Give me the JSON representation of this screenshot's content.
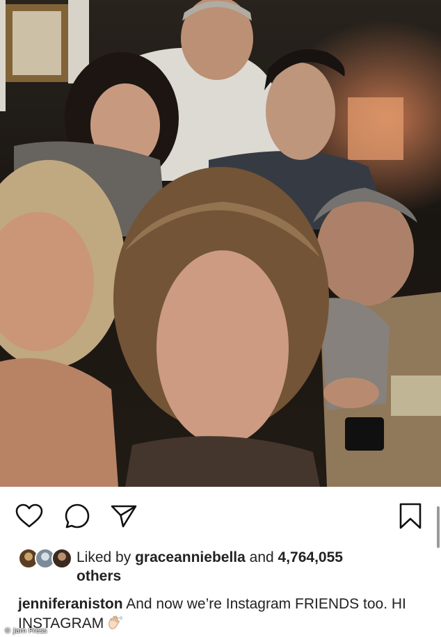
{
  "post": {
    "photo": {
      "description_icon": "group-selfie-photo"
    },
    "actions": {
      "like_icon": "heart-icon",
      "comment_icon": "comment-bubble-icon",
      "share_icon": "paper-plane-icon",
      "save_icon": "bookmark-icon"
    },
    "likes": {
      "prefix": "Liked by ",
      "user": "graceanniebella",
      "middle": " and ",
      "count": "4,764,055",
      "suffix": " others"
    },
    "caption": {
      "username": "jenniferaniston",
      "text": " And now we’re Instagram FRIENDS too. HI INSTAGRAM",
      "emoji_icon": "waving-hand-icon"
    },
    "watermark": "© Jam Press"
  },
  "colors": {
    "text": "#111111",
    "background": "#ffffff"
  }
}
